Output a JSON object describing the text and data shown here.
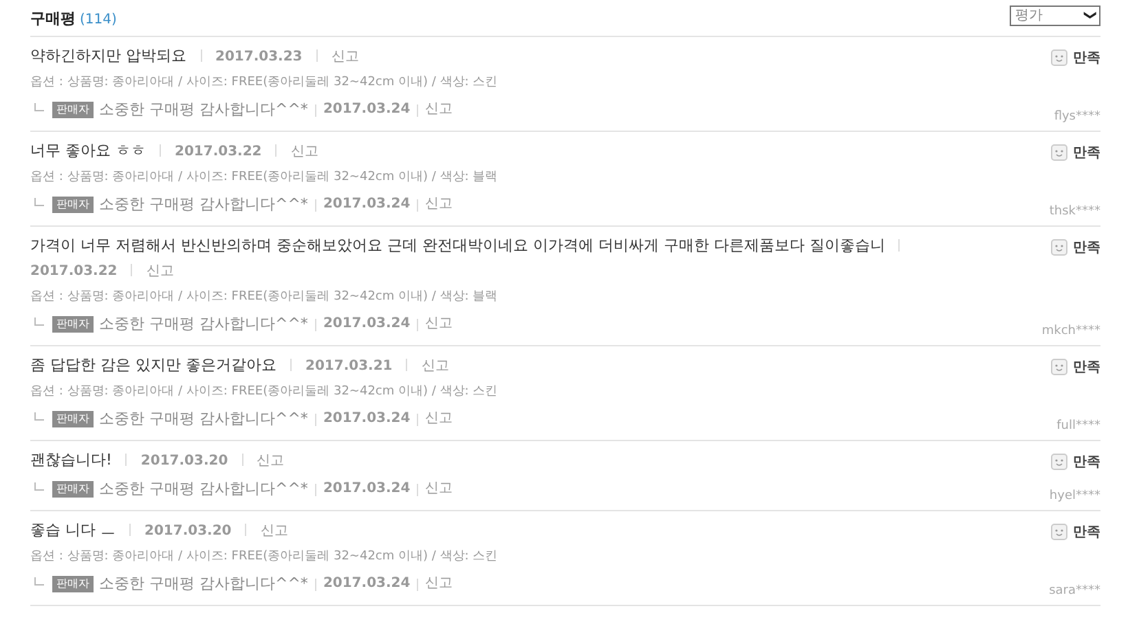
{
  "header": {
    "title": "구매평",
    "count": "(114)",
    "sort_select": {
      "value": "평가",
      "caret": "❯"
    }
  },
  "reviews": [
    {
      "title": "약하긴하지만 압박되요",
      "date": "2017.03.23",
      "report": "신고",
      "option": "옵션 : 상품명: 종아리아대 / 사이즈: FREE(종아리둘레 32~42cm 이내) / 색상: 스킨",
      "rating": "만족",
      "reply": {
        "badge": "판매자",
        "text": "소중한 구매평 감사합니다^^*",
        "date": "2017.03.24",
        "report": "신고"
      },
      "user": "flys****"
    },
    {
      "title": "너무 좋아요 ㅎㅎ",
      "date": "2017.03.22",
      "report": "신고",
      "option": "옵션 : 상품명: 종아리아대 / 사이즈: FREE(종아리둘레 32~42cm 이내) / 색상: 블랙",
      "rating": "만족",
      "reply": {
        "badge": "판매자",
        "text": "소중한 구매평 감사합니다^^*",
        "date": "2017.03.24",
        "report": "신고"
      },
      "user": "thsk****"
    },
    {
      "title": "가격이 너무 저렴해서 반신반의하며 중순해보았어요 근데 완전대박이네요 이가격에 더비싸게 구매한 다른제품보다 질이좋습니",
      "date": "2017.03.22",
      "report": "신고",
      "option": "옵션 : 상품명: 종아리아대 / 사이즈: FREE(종아리둘레 32~42cm 이내) / 색상: 블랙",
      "rating": "만족",
      "reply": {
        "badge": "판매자",
        "text": "소중한 구매평 감사합니다^^*",
        "date": "2017.03.24",
        "report": "신고"
      },
      "user": "mkch****"
    },
    {
      "title": "좀 답답한 감은 있지만 좋은거같아요",
      "date": "2017.03.21",
      "report": "신고",
      "option": "옵션 : 상품명: 종아리아대 / 사이즈: FREE(종아리둘레 32~42cm 이내) / 색상: 스킨",
      "rating": "만족",
      "reply": {
        "badge": "판매자",
        "text": "소중한 구매평 감사합니다^^*",
        "date": "2017.03.24",
        "report": "신고"
      },
      "user": "full****"
    },
    {
      "title": "괜찮습니다!",
      "date": "2017.03.20",
      "report": "신고",
      "rating": "만족",
      "reply": {
        "badge": "판매자",
        "text": "소중한 구매평 감사합니다^^*",
        "date": "2017.03.24",
        "report": "신고"
      },
      "user": "hyel****"
    },
    {
      "title": "좋습 니다 ㅡ",
      "date": "2017.03.20",
      "report": "신고",
      "option": "옵션 : 상품명: 종아리아대 / 사이즈: FREE(종아리둘레 32~42cm 이내) / 색상: 스킨",
      "rating": "만족",
      "reply": {
        "badge": "판매자",
        "text": "소중한 구매평 감사합니다^^*",
        "date": "2017.03.24",
        "report": "신고"
      },
      "user": "sara****"
    }
  ]
}
